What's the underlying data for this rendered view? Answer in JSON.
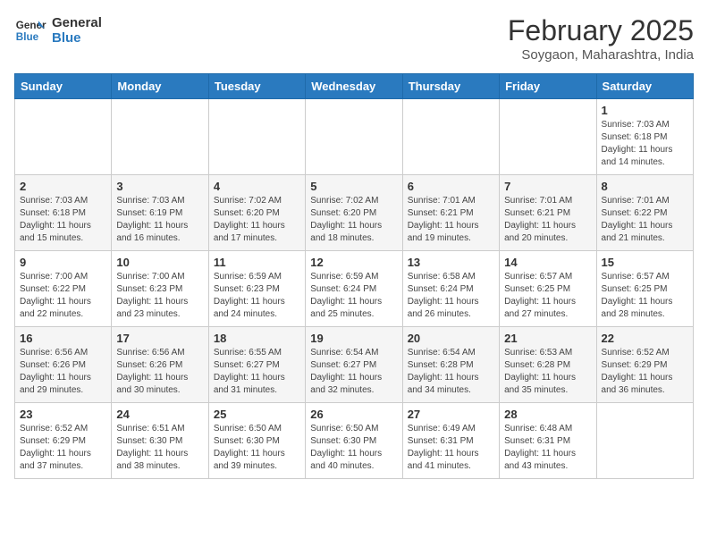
{
  "header": {
    "logo_line1": "General",
    "logo_line2": "Blue",
    "month": "February 2025",
    "location": "Soygaon, Maharashtra, India"
  },
  "days_of_week": [
    "Sunday",
    "Monday",
    "Tuesday",
    "Wednesday",
    "Thursday",
    "Friday",
    "Saturday"
  ],
  "weeks": [
    [
      {
        "day": "",
        "info": ""
      },
      {
        "day": "",
        "info": ""
      },
      {
        "day": "",
        "info": ""
      },
      {
        "day": "",
        "info": ""
      },
      {
        "day": "",
        "info": ""
      },
      {
        "day": "",
        "info": ""
      },
      {
        "day": "1",
        "info": "Sunrise: 7:03 AM\nSunset: 6:18 PM\nDaylight: 11 hours\nand 14 minutes."
      }
    ],
    [
      {
        "day": "2",
        "info": "Sunrise: 7:03 AM\nSunset: 6:18 PM\nDaylight: 11 hours\nand 15 minutes."
      },
      {
        "day": "3",
        "info": "Sunrise: 7:03 AM\nSunset: 6:19 PM\nDaylight: 11 hours\nand 16 minutes."
      },
      {
        "day": "4",
        "info": "Sunrise: 7:02 AM\nSunset: 6:20 PM\nDaylight: 11 hours\nand 17 minutes."
      },
      {
        "day": "5",
        "info": "Sunrise: 7:02 AM\nSunset: 6:20 PM\nDaylight: 11 hours\nand 18 minutes."
      },
      {
        "day": "6",
        "info": "Sunrise: 7:01 AM\nSunset: 6:21 PM\nDaylight: 11 hours\nand 19 minutes."
      },
      {
        "day": "7",
        "info": "Sunrise: 7:01 AM\nSunset: 6:21 PM\nDaylight: 11 hours\nand 20 minutes."
      },
      {
        "day": "8",
        "info": "Sunrise: 7:01 AM\nSunset: 6:22 PM\nDaylight: 11 hours\nand 21 minutes."
      }
    ],
    [
      {
        "day": "9",
        "info": "Sunrise: 7:00 AM\nSunset: 6:22 PM\nDaylight: 11 hours\nand 22 minutes."
      },
      {
        "day": "10",
        "info": "Sunrise: 7:00 AM\nSunset: 6:23 PM\nDaylight: 11 hours\nand 23 minutes."
      },
      {
        "day": "11",
        "info": "Sunrise: 6:59 AM\nSunset: 6:23 PM\nDaylight: 11 hours\nand 24 minutes."
      },
      {
        "day": "12",
        "info": "Sunrise: 6:59 AM\nSunset: 6:24 PM\nDaylight: 11 hours\nand 25 minutes."
      },
      {
        "day": "13",
        "info": "Sunrise: 6:58 AM\nSunset: 6:24 PM\nDaylight: 11 hours\nand 26 minutes."
      },
      {
        "day": "14",
        "info": "Sunrise: 6:57 AM\nSunset: 6:25 PM\nDaylight: 11 hours\nand 27 minutes."
      },
      {
        "day": "15",
        "info": "Sunrise: 6:57 AM\nSunset: 6:25 PM\nDaylight: 11 hours\nand 28 minutes."
      }
    ],
    [
      {
        "day": "16",
        "info": "Sunrise: 6:56 AM\nSunset: 6:26 PM\nDaylight: 11 hours\nand 29 minutes."
      },
      {
        "day": "17",
        "info": "Sunrise: 6:56 AM\nSunset: 6:26 PM\nDaylight: 11 hours\nand 30 minutes."
      },
      {
        "day": "18",
        "info": "Sunrise: 6:55 AM\nSunset: 6:27 PM\nDaylight: 11 hours\nand 31 minutes."
      },
      {
        "day": "19",
        "info": "Sunrise: 6:54 AM\nSunset: 6:27 PM\nDaylight: 11 hours\nand 32 minutes."
      },
      {
        "day": "20",
        "info": "Sunrise: 6:54 AM\nSunset: 6:28 PM\nDaylight: 11 hours\nand 34 minutes."
      },
      {
        "day": "21",
        "info": "Sunrise: 6:53 AM\nSunset: 6:28 PM\nDaylight: 11 hours\nand 35 minutes."
      },
      {
        "day": "22",
        "info": "Sunrise: 6:52 AM\nSunset: 6:29 PM\nDaylight: 11 hours\nand 36 minutes."
      }
    ],
    [
      {
        "day": "23",
        "info": "Sunrise: 6:52 AM\nSunset: 6:29 PM\nDaylight: 11 hours\nand 37 minutes."
      },
      {
        "day": "24",
        "info": "Sunrise: 6:51 AM\nSunset: 6:30 PM\nDaylight: 11 hours\nand 38 minutes."
      },
      {
        "day": "25",
        "info": "Sunrise: 6:50 AM\nSunset: 6:30 PM\nDaylight: 11 hours\nand 39 minutes."
      },
      {
        "day": "26",
        "info": "Sunrise: 6:50 AM\nSunset: 6:30 PM\nDaylight: 11 hours\nand 40 minutes."
      },
      {
        "day": "27",
        "info": "Sunrise: 6:49 AM\nSunset: 6:31 PM\nDaylight: 11 hours\nand 41 minutes."
      },
      {
        "day": "28",
        "info": "Sunrise: 6:48 AM\nSunset: 6:31 PM\nDaylight: 11 hours\nand 43 minutes."
      },
      {
        "day": "",
        "info": ""
      }
    ]
  ]
}
